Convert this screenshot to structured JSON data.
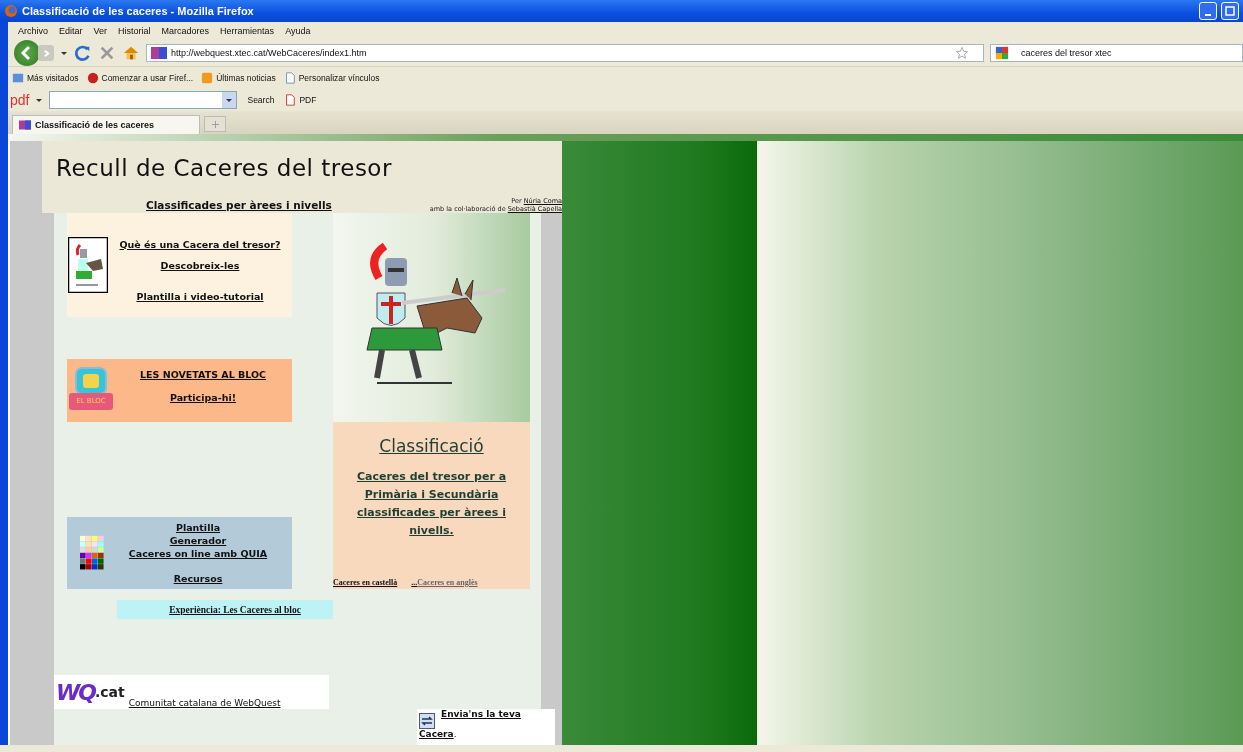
{
  "window": {
    "title": "Classificació de les caceres - Mozilla Firefox"
  },
  "menu": [
    "Archivo",
    "Editar",
    "Ver",
    "Historial",
    "Marcadores",
    "Herramientas",
    "Ayuda"
  ],
  "address_bar": {
    "url": "http://webquest.xtec.cat/WebCaceres/index1.htm"
  },
  "search_bar": {
    "value": "caceres del tresor xtec"
  },
  "bookmarks": [
    {
      "kind": "search",
      "label": "Más visitados"
    },
    {
      "kind": "red",
      "label": "Comenzar a usar Firef..."
    },
    {
      "kind": "rss",
      "label": "Últimas noticias"
    },
    {
      "kind": "page",
      "label": "Personalizar vínculos"
    }
  ],
  "pdf_toolbar": {
    "logo": "pdf",
    "search": "Search",
    "pdf": "PDF"
  },
  "tabs": [
    {
      "label": "Classificació de les caceres",
      "selected": true
    }
  ],
  "page": {
    "title": "Recull de Caceres del tresor",
    "subtitle": "Classificades per àrees i nivells",
    "credits": {
      "by": "Per",
      "author": "Núria Coma",
      "with": "amb la col·laboració de",
      "collaborator": "Sebastià Capella"
    },
    "intro_links": [
      "Què és una Cacera del tresor?",
      "Descobreix-les",
      "Plantilla i video-tutorial"
    ],
    "blog": {
      "icon_label": "EL BLOC",
      "links": [
        "LES NOVETATS AL BLOC",
        "Participa-hi!"
      ]
    },
    "tools_links": [
      "Plantilla",
      "Generador",
      "Caceres on line amb QUIA",
      "Recursos"
    ],
    "experience": "Experiència: Les Caceres al bloc",
    "classification": {
      "title": "Classificació",
      "description": "Caceres del tresor per a Primària i Secundària classificades per àrees i nivells.",
      "links": [
        "Caceres en castellà",
        "...",
        "Caceres en anglès"
      ]
    },
    "wq": {
      "logo": "WQ",
      "suffix": ".cat",
      "link": "Comunitat catalana de WebQuest"
    },
    "send": {
      "link1": "Envia'ns la teva",
      "link2": "Cacera",
      "tail": "."
    }
  }
}
